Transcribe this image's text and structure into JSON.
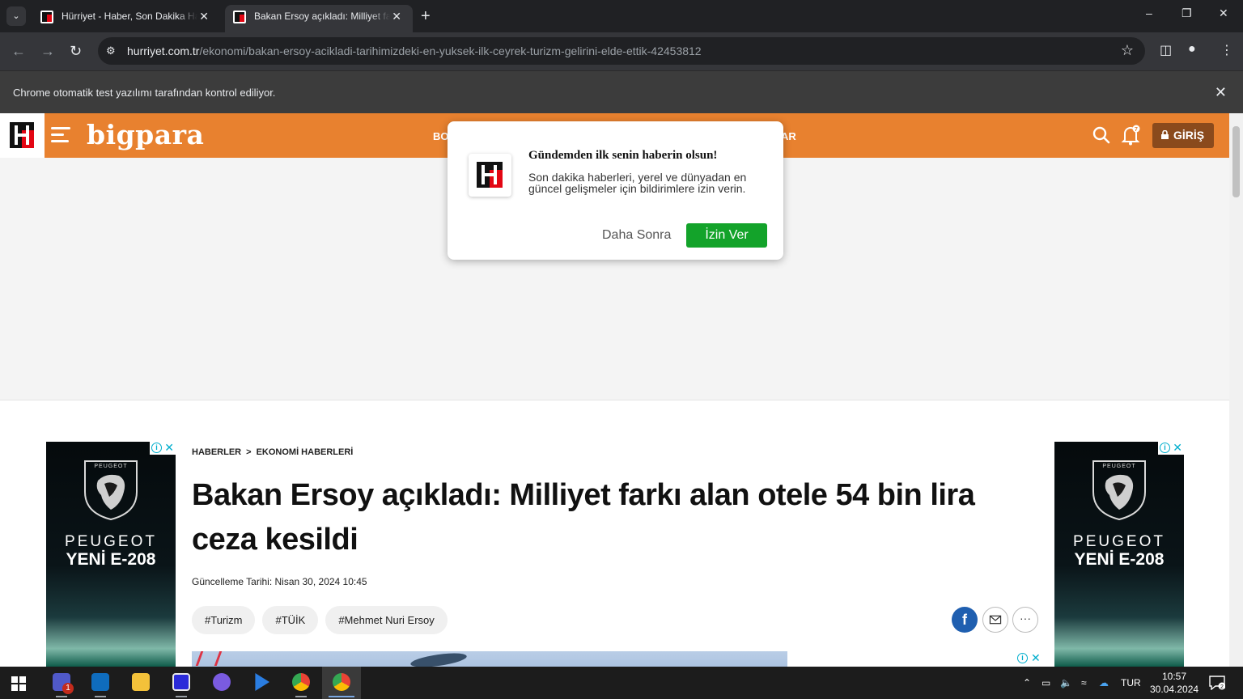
{
  "browser": {
    "tabs": [
      {
        "title": "Hürriyet - Haber, Son Dakika Haberler",
        "active": false
      },
      {
        "title": "Bakan Ersoy açıkladı: Milliyet farkı",
        "active": true
      }
    ],
    "url_domain": "hurriyet.com.tr",
    "url_path": "/ekonomi/bakan-ersoy-acikladi-tarihimizdeki-en-yuksek-ilk-ceyrek-turizm-gelirini-elde-ettik-42453812",
    "infobar_message": "Chrome otomatik test yazılımı tarafından kontrol ediliyor."
  },
  "site": {
    "brand": "bigpara",
    "nav_fragment_left": "BO",
    "nav_fragment_right": "AR",
    "bell_badge": "7",
    "login_label": "GİRİŞ"
  },
  "push_popup": {
    "title": "Gündemden ilk senin haberin olsun!",
    "body": "Son dakika haberleri, yerel ve dünyadan en güncel gelişmeler için bildirimlere izin verin.",
    "later_label": "Daha Sonra",
    "allow_label": "İzin Ver",
    "allow_color": "#13a32a"
  },
  "article": {
    "breadcrumb": [
      "HABERLER",
      "EKONOMİ HABERLERİ"
    ],
    "breadcrumb_sep": ">",
    "headline": "Bakan Ersoy açıkladı: Milliyet farkı alan otele 54 bin lira ceza kesildi",
    "updated": "Güncelleme Tarihi: Nisan 30, 2024 10:45",
    "tags": [
      "#Turizm",
      "#TÜİK",
      "#Mehmet Nuri Ersoy"
    ],
    "share": {
      "facebook": "f",
      "more": "···"
    }
  },
  "side_ads": {
    "logo_text": "PEUGEOT",
    "brand_line1": "PEUGEOT",
    "brand_line2": "YENİ E-208"
  },
  "taskbar": {
    "language": "TUR",
    "time": "10:57",
    "date": "30.04.2024",
    "notification_count": "2",
    "teams_badge": "1"
  },
  "colors": {
    "header_orange": "#e8812f",
    "login_brown": "#8a4a1c",
    "hurriyet_red": "#e30613"
  }
}
